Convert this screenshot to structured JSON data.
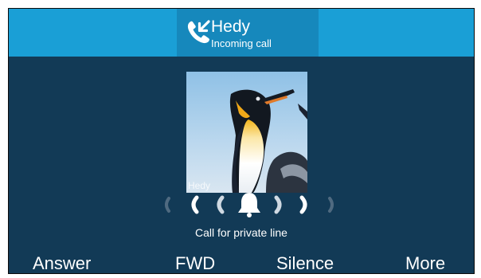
{
  "call": {
    "caller_name": "Hedy",
    "status": "Incoming call",
    "line_label": "Call for private line",
    "avatar_caption": "Hedy",
    "icon": "incoming-call-icon",
    "ring_icon": "bell-icon"
  },
  "softkeys": {
    "answer": "Answer",
    "fwd": "FWD",
    "silence": "Silence",
    "more": "More"
  },
  "colors": {
    "background": "#123a56",
    "top_bar": "#1a9fd6",
    "caller_box": "#1688bc",
    "text": "#ffffff"
  }
}
